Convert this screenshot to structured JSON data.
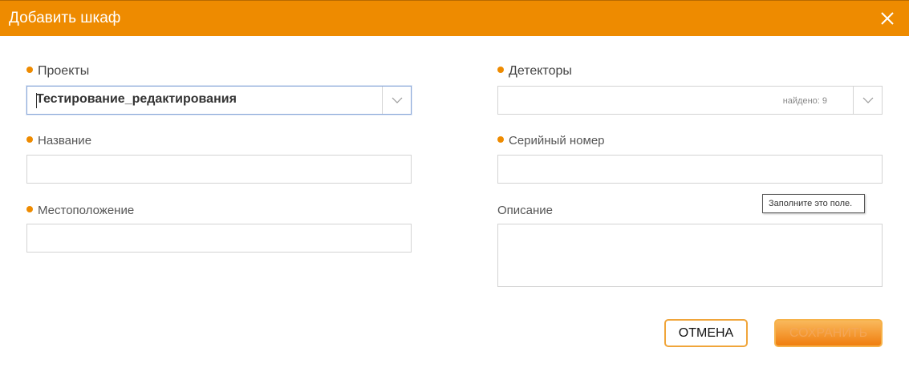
{
  "dialog": {
    "title": "Добавить шкаф",
    "close_icon": "close-icon"
  },
  "form": {
    "projects": {
      "label": "Проекты",
      "value": "Тестирование_редактирования",
      "required": true
    },
    "detectors": {
      "label": "Детекторы",
      "found_text": "найдено: 9",
      "required": true
    },
    "name": {
      "label": "Название",
      "value": "",
      "required": true
    },
    "serial": {
      "label": "Серийный номер",
      "value": "",
      "required": true
    },
    "location": {
      "label": "Местоположение",
      "value": "",
      "required": true
    },
    "description": {
      "label": "Описание",
      "value": "",
      "required": false
    }
  },
  "tooltip": {
    "text": "Заполните это поле."
  },
  "buttons": {
    "cancel_label": "ОТМЕНА",
    "save_label": "СОХРАНИТЬ"
  },
  "colors": {
    "accent": "#ee8b00",
    "header_text": "#ffffff",
    "focus_border": "#8aa7d8"
  }
}
